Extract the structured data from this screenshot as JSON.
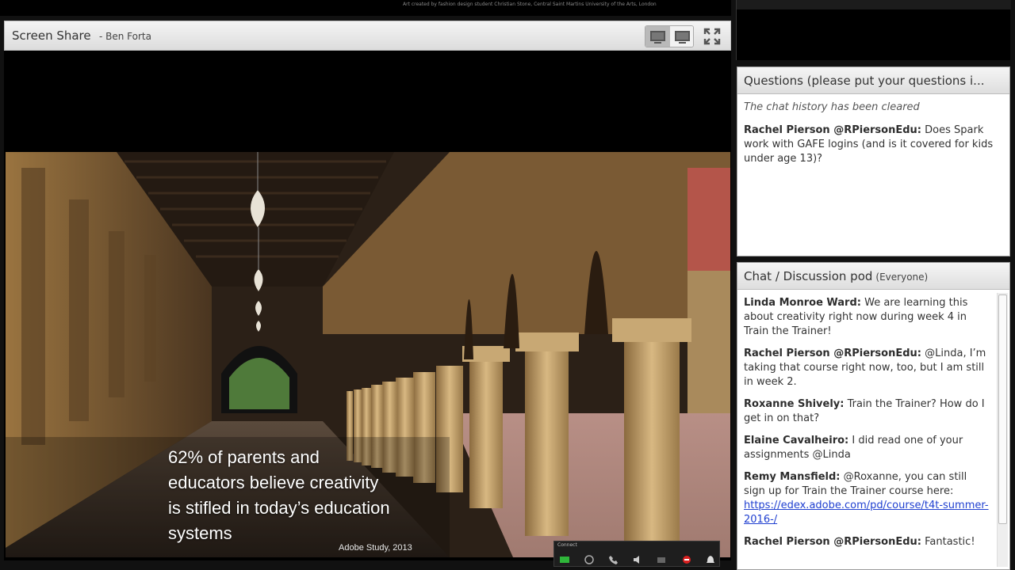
{
  "top_caption": "Art created by fashion design student Christian Stone, Central Saint Martins University of the Arts, London",
  "share_pod": {
    "title": "Screen Share",
    "presenter": "- Ben  Forta"
  },
  "slide": {
    "lines": [
      "62% of parents and",
      "educators believe creativity",
      "is stifled in today’s education",
      "systems"
    ],
    "source": "Adobe Study, 2013"
  },
  "mini_bar": {
    "title": "Connect"
  },
  "questions_pod": {
    "title": "Questions (please put your questions i...",
    "system_message": "The chat history has been cleared",
    "messages": [
      {
        "author": "Rachel Pierson @RPiersonEdu:",
        "text": " Does Spark work with GAFE logins (and is it covered for kids under age 13)?"
      }
    ]
  },
  "chat_pod": {
    "title": "Chat / Discussion pod",
    "scope": "(Everyone)",
    "messages": [
      {
        "author": "Linda Monroe Ward:",
        "text": " We are learning this about creativity right now during week 4 in Train the Trainer!"
      },
      {
        "author": "Rachel Pierson @RPiersonEdu:",
        "text": " @Linda, I’m taking that course right now, too, but I am still in week 2."
      },
      {
        "author": "Roxanne Shively:",
        "text": " Train the Trainer? How do I get in on that?"
      },
      {
        "author": "Elaine Cavalheiro:",
        "text": " I did read one of your assignments @Linda"
      },
      {
        "author": "Remy Mansfield:",
        "text": " @Roxanne, you can still sign up for Train the Trainer course here: ",
        "link": "https://edex.adobe.com/pd/course/t4t-summer-2016-/"
      },
      {
        "author": "Rachel Pierson @RPiersonEdu:",
        "text": " Fantastic!"
      }
    ]
  },
  "colors": {
    "link": "#1f3fd0",
    "pod_header": "#dedede"
  }
}
